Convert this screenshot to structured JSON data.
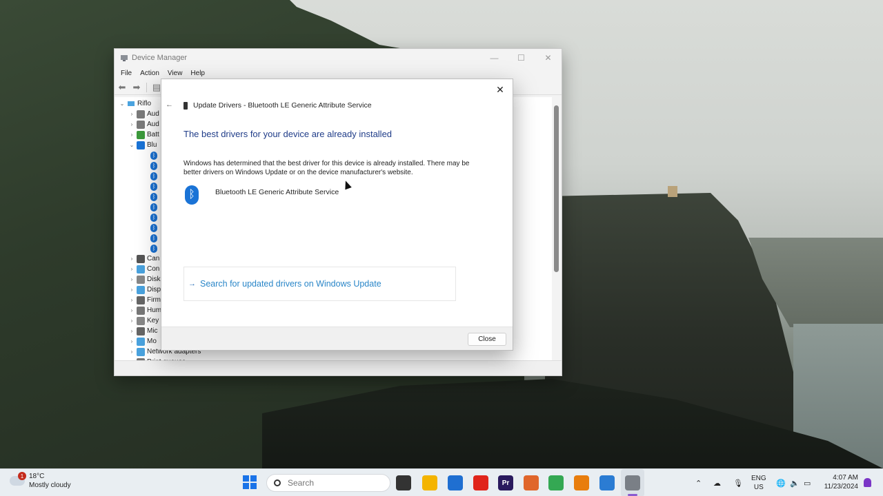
{
  "device_manager": {
    "title": "Device Manager",
    "menu": [
      "File",
      "Action",
      "View",
      "Help"
    ],
    "root": "Riflo",
    "tree": [
      {
        "label": "Aud",
        "chevron": "›",
        "icon_color": "#7a7a7a"
      },
      {
        "label": "Aud",
        "chevron": "›",
        "icon_color": "#7a7a7a"
      },
      {
        "label": "Batt",
        "chevron": "›",
        "icon_color": "#3c9a3c"
      },
      {
        "label": "Blu",
        "chevron": "⌄",
        "icon_color": "#1a73d6"
      },
      {
        "label": "Can",
        "chevron": "›",
        "icon_color": "#555555"
      },
      {
        "label": "Con",
        "chevron": "›",
        "icon_color": "#4aa3df"
      },
      {
        "label": "Disk",
        "chevron": "›",
        "icon_color": "#888888"
      },
      {
        "label": "Disp",
        "chevron": "›",
        "icon_color": "#4aa3df"
      },
      {
        "label": "Firm",
        "chevron": "›",
        "icon_color": "#666666"
      },
      {
        "label": "Hum",
        "chevron": "›",
        "icon_color": "#777777"
      },
      {
        "label": "Key",
        "chevron": "›",
        "icon_color": "#888888"
      },
      {
        "label": "Mic",
        "chevron": "›",
        "icon_color": "#666666"
      },
      {
        "label": "Mo",
        "chevron": "›",
        "icon_color": "#4aa3df"
      },
      {
        "label": "Network adapters",
        "chevron": "›",
        "icon_color": "#4aa3df"
      },
      {
        "label": "Print queues",
        "chevron": "›",
        "icon_color": "#777777"
      }
    ],
    "bluetooth_children_count": 10
  },
  "dialog": {
    "header": "Update Drivers - Bluetooth LE Generic Attribute Service",
    "heading": "The best drivers for your device are already installed",
    "description": "Windows has determined that the best driver for this device is already installed. There may be better drivers on Windows Update or on the device manufacturer's website.",
    "device_name": "Bluetooth LE Generic Attribute Service",
    "link_text": "Search for updated drivers on Windows Update",
    "close_button": "Close"
  },
  "taskbar": {
    "weather_temp": "18°C",
    "weather_desc": "Mostly cloudy",
    "weather_badge": "1",
    "search_placeholder": "Search",
    "lang_line1": "ENG",
    "lang_line2": "US",
    "time": "4:07 AM",
    "date": "11/23/2024",
    "apps": [
      {
        "name": "task-view-icon",
        "color": "#333333",
        "glyph": ""
      },
      {
        "name": "file-explorer-icon",
        "color": "#f4b400",
        "glyph": ""
      },
      {
        "name": "microsoft-store-icon",
        "color": "#1f6fd1",
        "glyph": ""
      },
      {
        "name": "red-diamond-app-icon",
        "color": "#e0251b",
        "glyph": ""
      },
      {
        "name": "premiere-pro-icon",
        "color": "#2a1a5e",
        "glyph": "Pr"
      },
      {
        "name": "matlab-icon",
        "color": "#e0662b",
        "glyph": ""
      },
      {
        "name": "chrome-icon",
        "color": "#34a853",
        "glyph": ""
      },
      {
        "name": "blender-icon",
        "color": "#e87d0d",
        "glyph": ""
      },
      {
        "name": "snipping-tool-icon",
        "color": "#2b7cd3",
        "glyph": ""
      },
      {
        "name": "device-manager-app-icon",
        "color": "#7a7f86",
        "glyph": ""
      }
    ]
  }
}
